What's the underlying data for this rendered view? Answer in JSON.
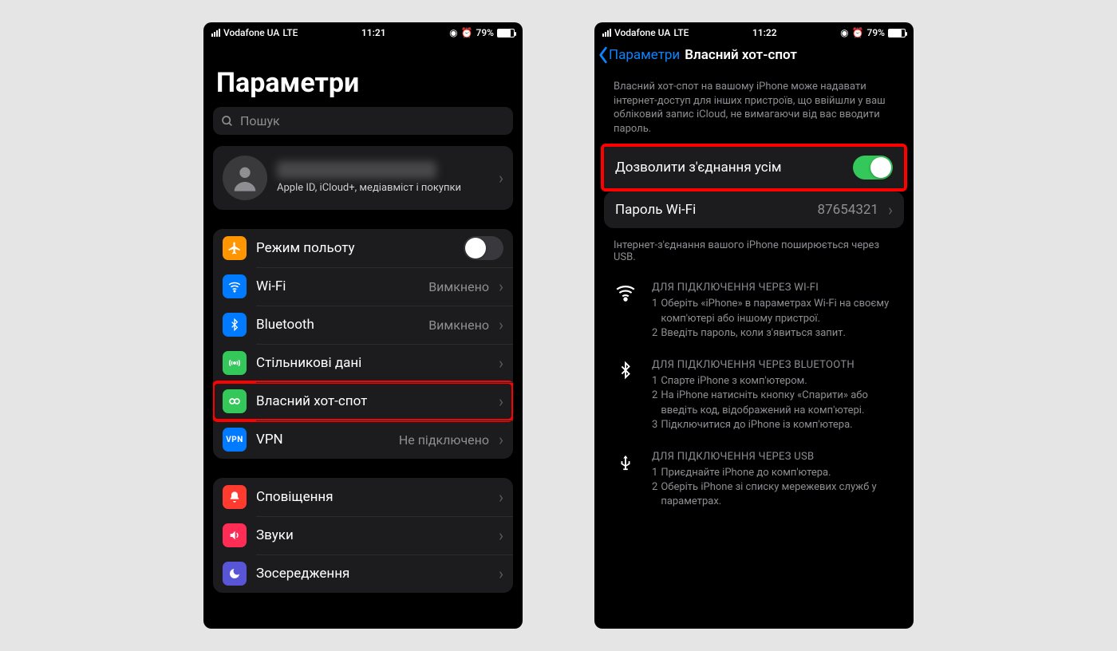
{
  "phone1": {
    "status": {
      "carrier": "Vodafone UA",
      "network": "LTE",
      "time": "11:21",
      "battery": "79%"
    },
    "title": "Параметри",
    "search_placeholder": "Пошук",
    "profile_sub": "Apple ID, iCloud+, медіавміст і покупки",
    "rows": {
      "airplane": "Режим польоту",
      "wifi": "Wi-Fi",
      "wifi_value": "Вимкнено",
      "bluetooth": "Bluetooth",
      "bluetooth_value": "Вимкнено",
      "cellular": "Стільникові дані",
      "hotspot": "Власний хот-спот",
      "vpn": "VPN",
      "vpn_value": "Не підключено",
      "notifications": "Сповіщення",
      "sounds": "Звуки",
      "focus": "Зосередження"
    }
  },
  "phone2": {
    "status": {
      "carrier": "Vodafone UA",
      "network": "LTE",
      "time": "11:22",
      "battery": "79%"
    },
    "back_label": "Параметри",
    "nav_title": "Власний хот-спот",
    "top_desc": "Власний хот-спот на вашому iPhone може надавати інтернет-доступ для інших пристроїв, що ввійшли у ваш обліковий запис iCloud, не вимагаючи від вас вводити пароль.",
    "allow_label": "Дозволити з'єднання усім",
    "wifi_pwd_label": "Пароль Wi-Fi",
    "wifi_pwd_value": "87654321",
    "usb_note": "Інтернет-з'єднання вашого iPhone поширюється через USB.",
    "wifi_head": "ДЛЯ ПІДКЛЮЧЕННЯ ЧЕРЕЗ WI-FI",
    "wifi_1": "Оберіть «iPhone» в параметрах Wi-Fi на своєму комп'ютері або іншому пристрої.",
    "wifi_2": "Введіть пароль, коли з'явиться запит.",
    "bt_head": "ДЛЯ ПІДКЛЮЧЕННЯ ЧЕРЕЗ BLUETOOTH",
    "bt_1": "Спарте iPhone з комп'ютером.",
    "bt_2": "На iPhone натисніть кнопку «Спарити» або введіть код, відображений на комп'ютері.",
    "bt_3": "Підключитися до iPhone із комп'ютера.",
    "usb_head": "ДЛЯ ПІДКЛЮЧЕННЯ ЧЕРЕЗ USB",
    "usb_1": "Приєднайте iPhone до комп'ютера.",
    "usb_2": "Оберіть iPhone зі списку мережевих служб у параметрах."
  }
}
